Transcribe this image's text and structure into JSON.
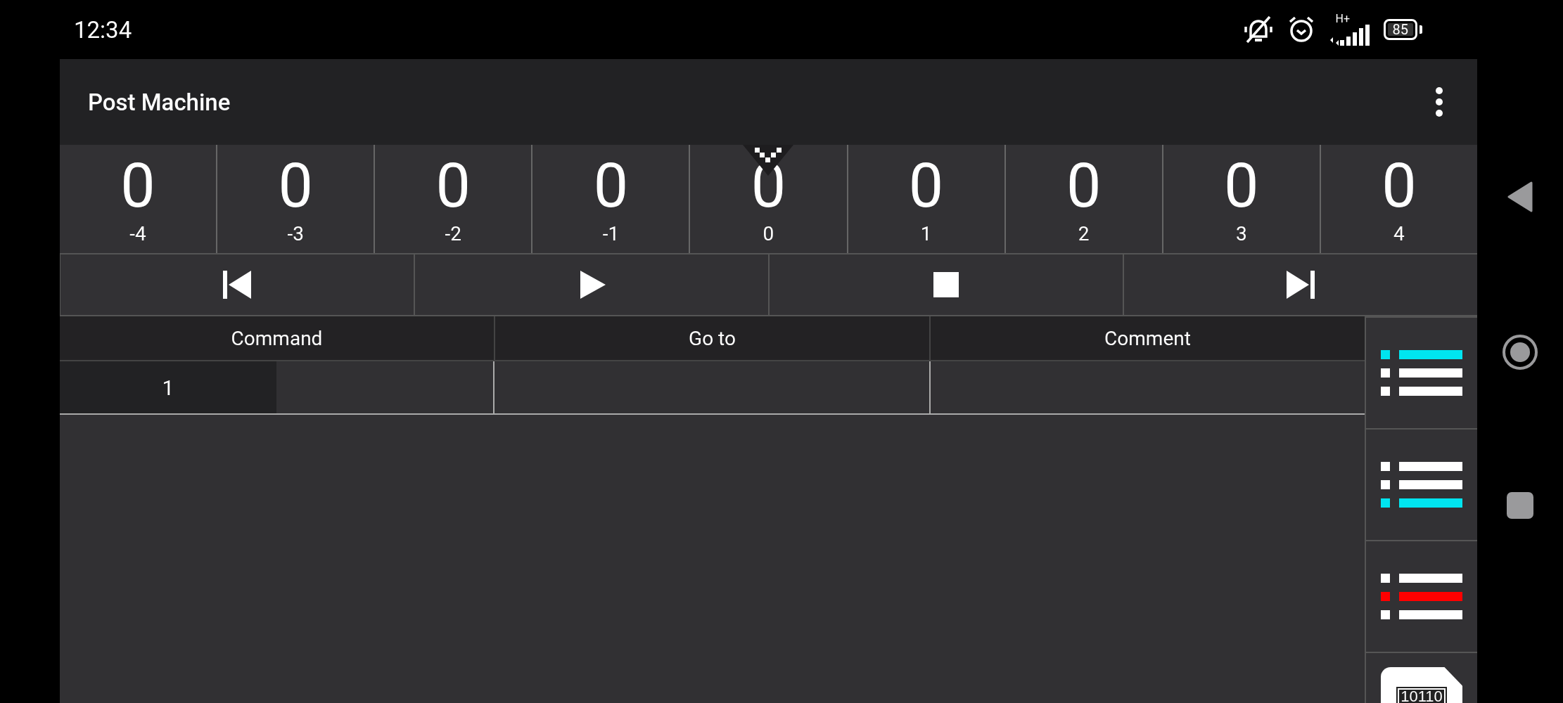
{
  "status_bar": {
    "time": "12:34",
    "network_type": "H+",
    "battery": "85"
  },
  "app_bar": {
    "title": "Post Machine"
  },
  "tape": [
    {
      "value": "0",
      "index": "-4",
      "selected": false
    },
    {
      "value": "0",
      "index": "-3",
      "selected": false
    },
    {
      "value": "0",
      "index": "-2",
      "selected": false
    },
    {
      "value": "0",
      "index": "-1",
      "selected": false
    },
    {
      "value": "0",
      "index": "0",
      "selected": true
    },
    {
      "value": "0",
      "index": "1",
      "selected": false
    },
    {
      "value": "0",
      "index": "2",
      "selected": false
    },
    {
      "value": "0",
      "index": "3",
      "selected": false
    },
    {
      "value": "0",
      "index": "4",
      "selected": false
    }
  ],
  "controls": [
    {
      "kind": "first"
    },
    {
      "kind": "play"
    },
    {
      "kind": "stop"
    },
    {
      "kind": "last"
    }
  ],
  "table": {
    "columns": [
      "Command",
      "Go to",
      "Comment"
    ],
    "rows": [
      {
        "number": "1"
      }
    ]
  },
  "side_buttons": [
    {
      "kind": "list",
      "color": "#00e5f0",
      "lines": [
        {
          "highlighted": true
        },
        {
          "highlighted": false
        },
        {
          "highlighted": false
        }
      ]
    },
    {
      "kind": "list",
      "color": "#00e5f0",
      "lines": [
        {
          "highlighted": false
        },
        {
          "highlighted": false
        },
        {
          "highlighted": true
        }
      ]
    },
    {
      "kind": "list",
      "color": "#ff0000",
      "lines": [
        {
          "highlighted": false
        },
        {
          "highlighted": true
        },
        {
          "highlighted": false
        }
      ]
    },
    {
      "kind": "file",
      "label": "10110"
    }
  ]
}
